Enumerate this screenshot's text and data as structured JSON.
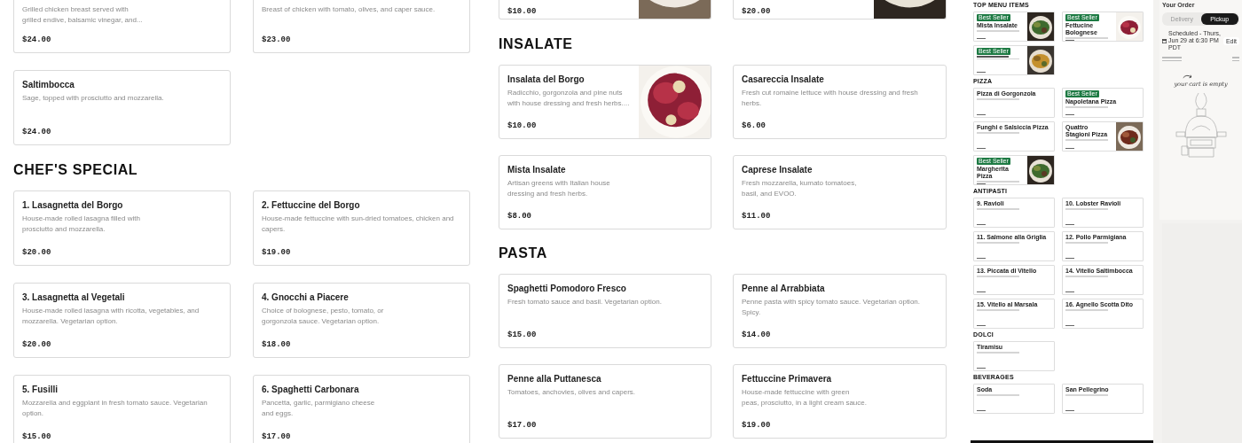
{
  "menu_left": {
    "sections": [
      {
        "items": [
          {
            "description_lines": [
              "Grilled chicken breast served with",
              "grilled endive, balsamic vinegar, and..."
            ],
            "price": "$24.00"
          },
          {
            "description_lines": [
              "Breast of chicken with tomato, olives, and caper sauce."
            ],
            "price": "$23.00"
          },
          {
            "name": "Saltimbocca",
            "description_lines": [
              "Sage, topped with prosciutto and mozzarella."
            ],
            "price": "$24.00"
          }
        ]
      },
      {
        "heading": "CHEF'S SPECIAL",
        "items": [
          {
            "name": "1. Lasagnetta del Borgo",
            "description_lines": [
              "House-made rolled lasagna filled with",
              "prosciutto and mozzarella."
            ],
            "price": "$20.00"
          },
          {
            "name": "2. Fettuccine del Borgo",
            "description_lines": [
              "House-made fettuccine with sun-dried tomatoes, chicken and",
              "capers."
            ],
            "price": "$19.00"
          },
          {
            "name": "3. Lasagnetta al Vegetali",
            "description_lines": [
              "House-made rolled lasagna with ricotta, vegetables, and",
              "mozzarella. Vegetarian option."
            ],
            "price": "$20.00"
          },
          {
            "name": "4. Gnocchi a Piacere",
            "description_lines": [
              "Choice of bolognese, pesto, tomato, or",
              "gorgonzola sauce. Vegetarian option."
            ],
            "price": "$18.00"
          },
          {
            "name": "5. Fusilli",
            "description_lines": [
              "Mozzarella and eggplant in fresh tomato sauce. Vegetarian",
              "option."
            ],
            "price": "$15.00"
          },
          {
            "name": "6. Spaghetti Carbonara",
            "description_lines": [
              "Pancetta, garlic, parmigiano cheese",
              "and eggs."
            ],
            "price": "$17.00"
          }
        ]
      }
    ]
  },
  "menu_middle": {
    "sections": [
      {
        "items": [
          {
            "price": "$10.00",
            "picture": {
              "kind": "picture"
            }
          },
          {
            "price": "$20.00",
            "picture": {
              "kind": "picture"
            }
          }
        ]
      },
      {
        "heading": "INSALATE",
        "items": [
          {
            "name": "Insalata del Borgo",
            "description_lines": [
              "Radicchio, gorgonzola and pine nuts",
              "with house dressing and fresh herbs...."
            ],
            "price": "$10.00",
            "picture": {
              "kind": "picture"
            }
          },
          {
            "name": "Casareccia Insalate",
            "description_lines": [
              "Fresh cut romaine lettuce with house dressing and fresh",
              "herbs."
            ],
            "price": "$6.00"
          },
          {
            "name": "Mista Insalate",
            "description_lines": [
              "Artisan greens with Italian house",
              "dressing and fresh herbs."
            ],
            "price": "$8.00"
          },
          {
            "name": "Caprese Insalate",
            "description_lines": [
              "Fresh mozzarella, kumato tomatoes,",
              "basil, and EVOO."
            ],
            "price": "$11.00"
          }
        ]
      },
      {
        "heading": "PASTA",
        "items": [
          {
            "name": "Spaghetti Pomodoro Fresco",
            "description_lines": [
              "Fresh tomato sauce and basil. Vegetarian option."
            ],
            "price": "$15.00"
          },
          {
            "name": "Penne al Arrabbiata",
            "description_lines": [
              "Penne pasta with spicy tomato sauce. Vegetarian option.",
              "Spicy."
            ],
            "price": "$14.00"
          },
          {
            "name": "Penne alla Puttanesca",
            "description_lines": [
              "Tomatoes, anchovies, olives and capers."
            ],
            "price": "$17.00"
          },
          {
            "name": "Fettuccine Primavera",
            "description_lines": [
              "House-made fettuccine with green",
              "peas, prosciutto, in a light cream sauce."
            ],
            "price": "$19.00"
          }
        ]
      }
    ]
  },
  "page_preview": {
    "sections": [
      {
        "heading": "TOP MENU ITEMS",
        "items": [
          {
            "badge": "Best Seller",
            "name": "Mista Insalate",
            "picture": {
              "kind": "picture"
            }
          },
          {
            "badge": "Best Seller",
            "name": "Fettucine Bolognese",
            "picture": {
              "kind": "picture"
            }
          },
          {
            "badge": "Best Seller",
            "picture": {
              "kind": "picture"
            }
          }
        ]
      },
      {
        "heading": "PIZZA",
        "items": [
          {
            "name": "Pizza di Gorgonzola"
          },
          {
            "badge": "Best Seller",
            "name": "Napoletana Pizza"
          },
          {
            "name": "Funghi e Salsiccia Pizza"
          },
          {
            "name": "Quattro Stagioni Pizza",
            "picture": {
              "kind": "picture"
            }
          },
          {
            "badge": "Best Seller",
            "name": "Margherita Pizza",
            "picture": {
              "kind": "picture"
            }
          }
        ]
      },
      {
        "heading": "ANTIPASTI",
        "items": [
          {
            "name": "9. Ravioli"
          },
          {
            "name": "10. Lobster Ravioli"
          },
          {
            "name": "11. Salmone alla Griglia"
          },
          {
            "name": "12. Pollo Parmigiana"
          },
          {
            "name": "13. Piccata di Vitello"
          },
          {
            "name": "14. Vitello Saltimbocca"
          },
          {
            "name": "15. Vitello al Marsala"
          },
          {
            "name": "16. Agnello Scotta Dito"
          }
        ]
      },
      {
        "heading": "DOLCI",
        "items": [
          {
            "name": "Tiramisu"
          }
        ]
      },
      {
        "heading": "BEVERAGES",
        "items": [
          {
            "name": "Soda"
          },
          {
            "name": "San Pellegrino"
          }
        ]
      }
    ]
  },
  "order": {
    "title": "Your Order",
    "tabs": [
      {
        "label": "Delivery",
        "selected": false
      },
      {
        "label": "Pickup",
        "selected": true
      }
    ],
    "schedule": "Scheduled - Thurs, Jun 29 at 6:30 PM PDT",
    "edit": "Edit",
    "empty_message": "your cart is empty"
  }
}
